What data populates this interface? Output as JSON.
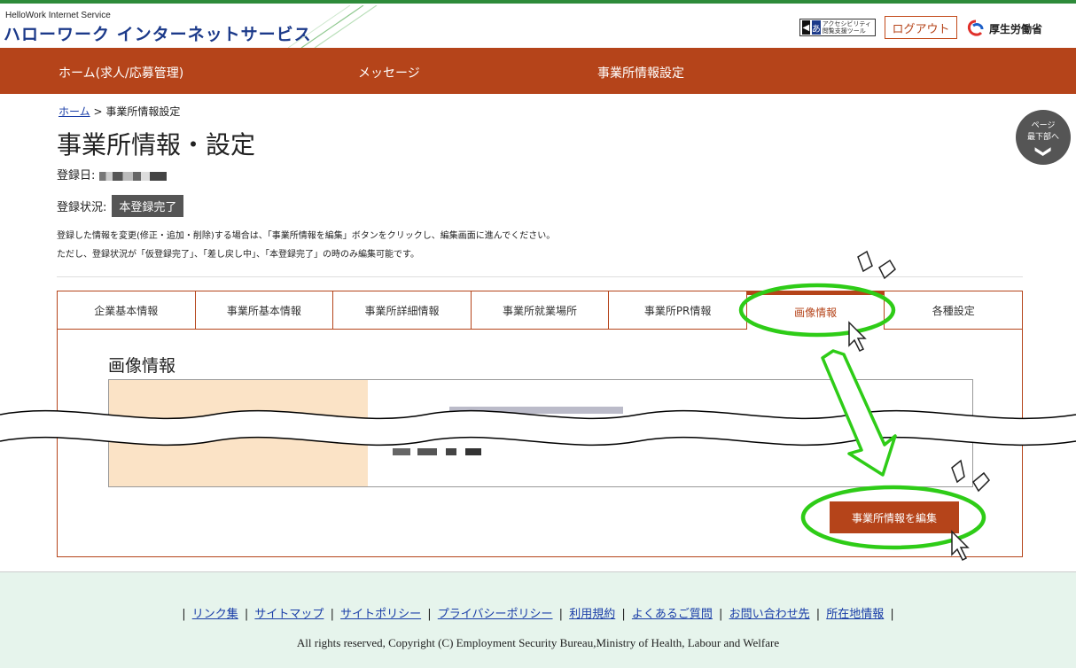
{
  "header": {
    "logo_sub": "HelloWork Internet Service",
    "logo_main": "ハローワーク インターネットサービス",
    "a11y_tool_icon": "speaker-icon",
    "a11y_tool_kana": "あ",
    "a11y_tool_text": "アクセシビリティ閲覧支援ツール",
    "logout_label": "ログアウト",
    "ministry_name": "厚生労働省"
  },
  "nav": {
    "items": [
      {
        "label": "ホーム(求人/応募管理)"
      },
      {
        "label": "メッセージ"
      },
      {
        "label": "事業所情報設定"
      }
    ]
  },
  "breadcrumb": {
    "home": "ホーム",
    "separator": ">",
    "current": "事業所情報設定"
  },
  "page": {
    "title": "事業所情報・設定",
    "reg_date_label": "登録日:",
    "reg_status_label": "登録状況:",
    "reg_status_value": "本登録完了",
    "note_line1": "登録した情報を変更(修正・追加・削除)する場合は、「事業所情報を編集」ボタンをクリックし、編集画面に進んでください。",
    "note_line2": "ただし、登録状況が「仮登録完了」、「差し戻し中」、「本登録完了」の時のみ編集可能です。"
  },
  "scroll_button": {
    "line1": "ページ",
    "line2": "最下部へ",
    "chevron": "❯"
  },
  "tabs": [
    {
      "label": "企業基本情報",
      "active": false
    },
    {
      "label": "事業所基本情報",
      "active": false
    },
    {
      "label": "事業所詳細情報",
      "active": false
    },
    {
      "label": "事業所就業場所",
      "active": false
    },
    {
      "label": "事業所PR情報",
      "active": false
    },
    {
      "label": "画像情報",
      "active": true
    },
    {
      "label": "各種設定",
      "active": false
    }
  ],
  "panel": {
    "title": "画像情報",
    "edit_button": "事業所情報を編集"
  },
  "footer": {
    "links": [
      "リンク集",
      "サイトマップ",
      "サイトポリシー",
      "プライバシーポリシー",
      "利用規約",
      "よくあるご質問",
      "お問い合わせ先",
      "所在地情報"
    ],
    "separator": "|",
    "copyright": "All rights reserved, Copyright (C) Employment Security Bureau,Ministry of Health, Labour and Welfare"
  },
  "colors": {
    "brand": "#b5441a",
    "accent_green": "#2ecc17",
    "logo_blue": "#1c3a8a",
    "footer_bg": "#e6f4ec"
  }
}
